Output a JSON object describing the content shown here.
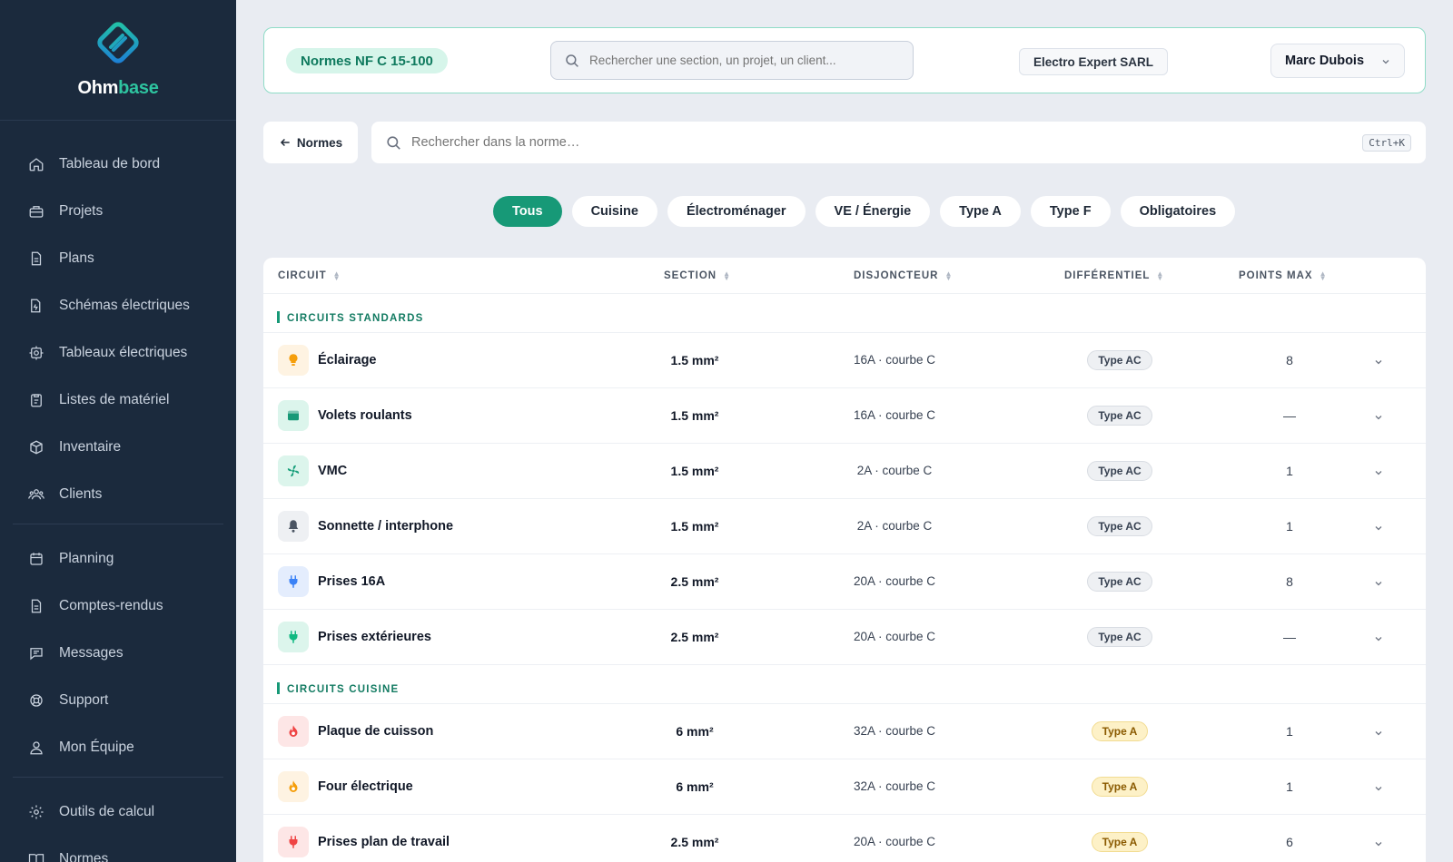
{
  "app": {
    "brand_main": "Ohm",
    "brand_accent": "base"
  },
  "sidebar": {
    "items": [
      {
        "label": "Tableau de bord",
        "icon": "home-icon"
      },
      {
        "label": "Projets",
        "icon": "briefcase-icon"
      },
      {
        "label": "Plans",
        "icon": "document-icon"
      },
      {
        "label": "Schémas électriques",
        "icon": "schema-icon"
      },
      {
        "label": "Tableaux électriques",
        "icon": "panel-icon"
      },
      {
        "label": "Listes de matériel",
        "icon": "clipboard-icon"
      },
      {
        "label": "Inventaire",
        "icon": "box-icon"
      },
      {
        "label": "Clients",
        "icon": "users-icon"
      },
      {
        "label": "Planning",
        "icon": "calendar-icon"
      },
      {
        "label": "Comptes-rendus",
        "icon": "report-icon"
      },
      {
        "label": "Messages",
        "icon": "message-icon"
      },
      {
        "label": "Support",
        "icon": "lifebuoy-icon"
      },
      {
        "label": "Mon Équipe",
        "icon": "team-icon"
      },
      {
        "label": "Outils de calcul",
        "icon": "gear-icon"
      },
      {
        "label": "Normes",
        "icon": "book-icon"
      }
    ]
  },
  "topbar": {
    "norme_badge": "Normes NF C 15-100",
    "search_placeholder": "Rechercher une section, un projet, un client...",
    "company": "Electro Expert SARL",
    "user": "Marc Dubois"
  },
  "toolbar": {
    "back_label": "Normes",
    "search_placeholder": "Rechercher dans la norme…",
    "shortcut": "Ctrl+K"
  },
  "filters": [
    {
      "label": "Tous",
      "active": true
    },
    {
      "label": "Cuisine",
      "active": false
    },
    {
      "label": "Électroménager",
      "active": false
    },
    {
      "label": "VE / Énergie",
      "active": false
    },
    {
      "label": "Type A",
      "active": false
    },
    {
      "label": "Type F",
      "active": false
    },
    {
      "label": "Obligatoires",
      "active": false
    }
  ],
  "table": {
    "columns": [
      "CIRCUIT",
      "SECTION",
      "DISJONCTEUR",
      "DIFFÉRENTIEL",
      "POINTS MAX"
    ],
    "groups": [
      {
        "title": "CIRCUITS STANDARDS",
        "rows": [
          {
            "name": "Éclairage",
            "section": "1.5 mm²",
            "disjoncteur": "16A · courbe C",
            "differentiel": "Type AC",
            "points": "8",
            "icon": "bulb-icon",
            "icon_bg": "#fef3e2",
            "icon_color": "#f59e0b"
          },
          {
            "name": "Volets roulants",
            "section": "1.5 mm²",
            "disjoncteur": "16A · courbe C",
            "differentiel": "Type AC",
            "points": "—",
            "icon": "shutter-icon",
            "icon_bg": "#dcf5ec",
            "icon_color": "#179977"
          },
          {
            "name": "VMC",
            "section": "1.5 mm²",
            "disjoncteur": "2A · courbe C",
            "differentiel": "Type AC",
            "points": "1",
            "icon": "fan-icon",
            "icon_bg": "#dcf5ec",
            "icon_color": "#1aa07c"
          },
          {
            "name": "Sonnette / interphone",
            "section": "1.5 mm²",
            "disjoncteur": "2A · courbe C",
            "differentiel": "Type AC",
            "points": "1",
            "icon": "bell-icon",
            "icon_bg": "#eef0f3",
            "icon_color": "#4b5563"
          },
          {
            "name": "Prises 16A",
            "section": "2.5 mm²",
            "disjoncteur": "20A · courbe C",
            "differentiel": "Type AC",
            "points": "8",
            "icon": "plug-icon",
            "icon_bg": "#e4edfd",
            "icon_color": "#3b82f6"
          },
          {
            "name": "Prises extérieures",
            "section": "2.5 mm²",
            "disjoncteur": "20A · courbe C",
            "differentiel": "Type AC",
            "points": "—",
            "icon": "plug-outdoor-icon",
            "icon_bg": "#dcf5ec",
            "icon_color": "#10b981"
          }
        ]
      },
      {
        "title": "CIRCUITS CUISINE",
        "rows": [
          {
            "name": "Plaque de cuisson",
            "section": "6 mm²",
            "disjoncteur": "32A · courbe C",
            "differentiel": "Type A",
            "points": "1",
            "icon": "flame-icon",
            "icon_bg": "#fde6e6",
            "icon_color": "#ef4444"
          },
          {
            "name": "Four électrique",
            "section": "6 mm²",
            "disjoncteur": "32A · courbe C",
            "differentiel": "Type A",
            "points": "1",
            "icon": "oven-flame-icon",
            "icon_bg": "#fef3e2",
            "icon_color": "#f59e0b"
          },
          {
            "name": "Prises plan de travail",
            "section": "2.5 mm²",
            "disjoncteur": "20A · courbe C",
            "differentiel": "Type A",
            "points": "6",
            "icon": "plug-kitchen-icon",
            "icon_bg": "#fde6e6",
            "icon_color": "#ef4444"
          }
        ]
      }
    ]
  },
  "colors": {
    "accent": "#179977",
    "sidebar_bg": "#1b2a3d",
    "page_bg": "#e9ecf2"
  }
}
